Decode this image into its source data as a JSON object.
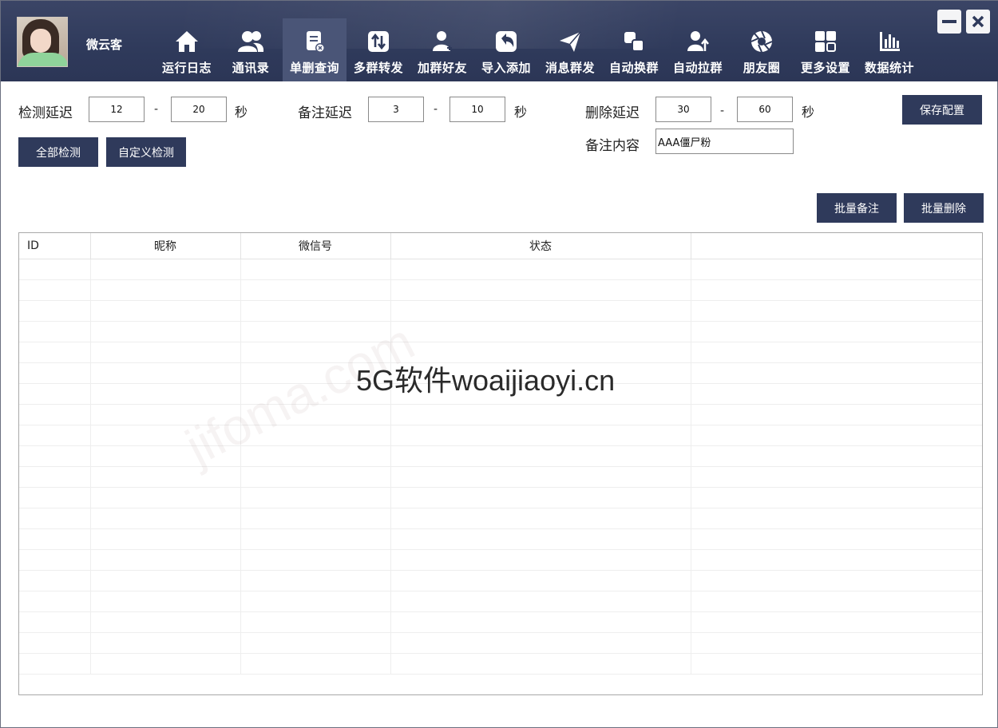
{
  "header": {
    "username": "微云客",
    "nav": [
      {
        "label": "运行日志",
        "icon": "home-icon",
        "active": false
      },
      {
        "label": "通讯录",
        "icon": "contacts-icon",
        "active": false
      },
      {
        "label": "单删查询",
        "icon": "delete-query-icon",
        "active": true
      },
      {
        "label": "多群转发",
        "icon": "forward-icon",
        "active": false
      },
      {
        "label": "加群好友",
        "icon": "add-friend-icon",
        "active": false
      },
      {
        "label": "导入添加",
        "icon": "import-icon",
        "active": false
      },
      {
        "label": "消息群发",
        "icon": "send-icon",
        "active": false
      },
      {
        "label": "自动换群",
        "icon": "switch-group-icon",
        "active": false
      },
      {
        "label": "自动拉群",
        "icon": "pull-group-icon",
        "active": false
      },
      {
        "label": "朋友圈",
        "icon": "moments-icon",
        "active": false
      },
      {
        "label": "更多设置",
        "icon": "grid-settings-icon",
        "active": false
      },
      {
        "label": "数据统计",
        "icon": "bar-chart-icon",
        "active": false
      }
    ]
  },
  "settings": {
    "detect_delay": {
      "label": "检测延迟",
      "min": "12",
      "max": "20",
      "unit": "秒"
    },
    "remark_delay": {
      "label": "备注延迟",
      "min": "3",
      "max": "10",
      "unit": "秒"
    },
    "delete_delay": {
      "label": "删除延迟",
      "min": "30",
      "max": "60",
      "unit": "秒"
    },
    "dash": "-",
    "remark_content": {
      "label": "备注内容",
      "value": "AAA僵尸粉"
    },
    "save_label": "保存配置",
    "detect_all_label": "全部检测",
    "custom_detect_label": "自定义检测",
    "batch_remark_label": "批量备注",
    "batch_delete_label": "批量删除"
  },
  "table": {
    "columns": [
      "ID",
      "昵称",
      "微信号",
      "状态",
      ""
    ],
    "rows": []
  },
  "overlay": {
    "watermark_text": "5G软件woaijiaoyi.cn",
    "faint_watermark": "jifoma.com"
  },
  "colors": {
    "header_bg": "#2f3a5b",
    "active_tab": "#4a5577",
    "button_bg": "#2f3a5b"
  }
}
